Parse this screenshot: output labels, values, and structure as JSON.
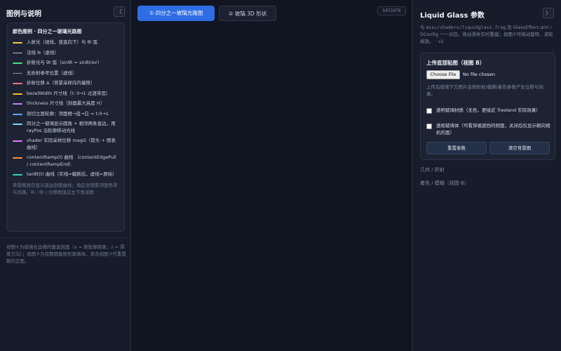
{
  "left_panel": {
    "title": "图例与说明",
    "collapse_label": "〈",
    "legend": {
      "title": "颜色图例 · 四分之一玻璃光路图",
      "items": [
        {
          "text": "入射光（视线，竖直向下）与 θi 弧",
          "color": "#f2c94c",
          "dashed": false
        },
        {
          "text": "法线 N（虚线）",
          "color": "#c9d1de",
          "dashed": true
        },
        {
          "text": "折射光与 θt 弧（sinθt = sinθi/ior）",
          "color": "#4ade80",
          "dashed": false
        },
        {
          "text": "无折射参考位置（虚线）",
          "color": "#9aa4b8",
          "dashed": true
        },
        {
          "text": "折射位移 Δ（背景采样向内偏移）",
          "color": "#f87171",
          "dashed": false
        },
        {
          "text": "bezelWidth 尺寸线（t: 0→1 过渡带宽）",
          "color": "#fbbf24",
          "dashed": false
        },
        {
          "text": "thickness 尺寸线（剖面最大高度 H）",
          "color": "#c084fc",
          "dashed": false
        },
        {
          "text": "剖切立面轮廓：顶面橙→蓝→白 = t:0→1",
          "color": "#60a5fa",
          "dashed": false
        },
        {
          "text": "四分之一玻璃显示圆角 + 相邻两条直边，用 rayPos 沿轮廓移动光线",
          "color": "#7dd3fc",
          "dashed": false
        },
        {
          "text": "shader 实际采样位移 magG（箭头 + 图表曲线）",
          "color": "#e879f9",
          "dashed": false
        },
        {
          "text": "contentRamp(t) 曲线 （contentEdgePull / contentRampEnd）",
          "color": "#fb923c",
          "dashed": false
        },
        {
          "text": "tanθt(t) 曲线（实线=截断后，虚线=原始）",
          "color": "#2dd4bf",
          "dashed": false
        }
      ],
      "note": "背景图表仍显示直边剖面曲线；角区处理看顶面色带与光路。θi / θt / 位移数值见左下角读数"
    },
    "footer": "视图①为玻璃右边缘的垂直剖面（x = 距轮廓距离，z = 厚度方向）；视图②为完整圆角矩形玻璃体。双击视图②可重置朝向正面。"
  },
  "center": {
    "tabs": [
      {
        "label": "① 四分之一玻璃光路图",
        "active": true
      },
      {
        "label": "② 玻璃 3D 形状",
        "active": false
      }
    ],
    "build_hash": "b972d78"
  },
  "right_panel": {
    "title": "Liquid Glass 参数",
    "collapse_label": "〉",
    "desc_prefix": "与 ",
    "desc_file": "misc/shaders/liquidglass.frag",
    "desc_mid": " 及 GlassEffect.qml / DConfig 一一对应。拖动滑条实时重建；视图②可拖动旋转、滚轮缩放。",
    "desc_version": " · v2",
    "upload": {
      "title": "上传底部贴图（视图 B）",
      "file_button": "Choose File",
      "file_status": "No file chosen",
      "hint": "上传后玻璃下方图片会按折射/模糊/着色参数产生位移与效果。",
      "options": [
        {
          "label": "透明玻璃材质（无色，更接近 Treeland 实际效果）",
          "checked": false
        },
        {
          "label": "透视玻璃体（可看穿被遮挡的侧面，关闭后仅显示朝向相机的面）",
          "checked": false
        }
      ],
      "reset_button": "重置参数",
      "clear_button": "清空背景图"
    },
    "sections": [
      {
        "label": "几何 / 折射"
      },
      {
        "label": "着色 / 模糊（视图 B）"
      }
    ]
  }
}
